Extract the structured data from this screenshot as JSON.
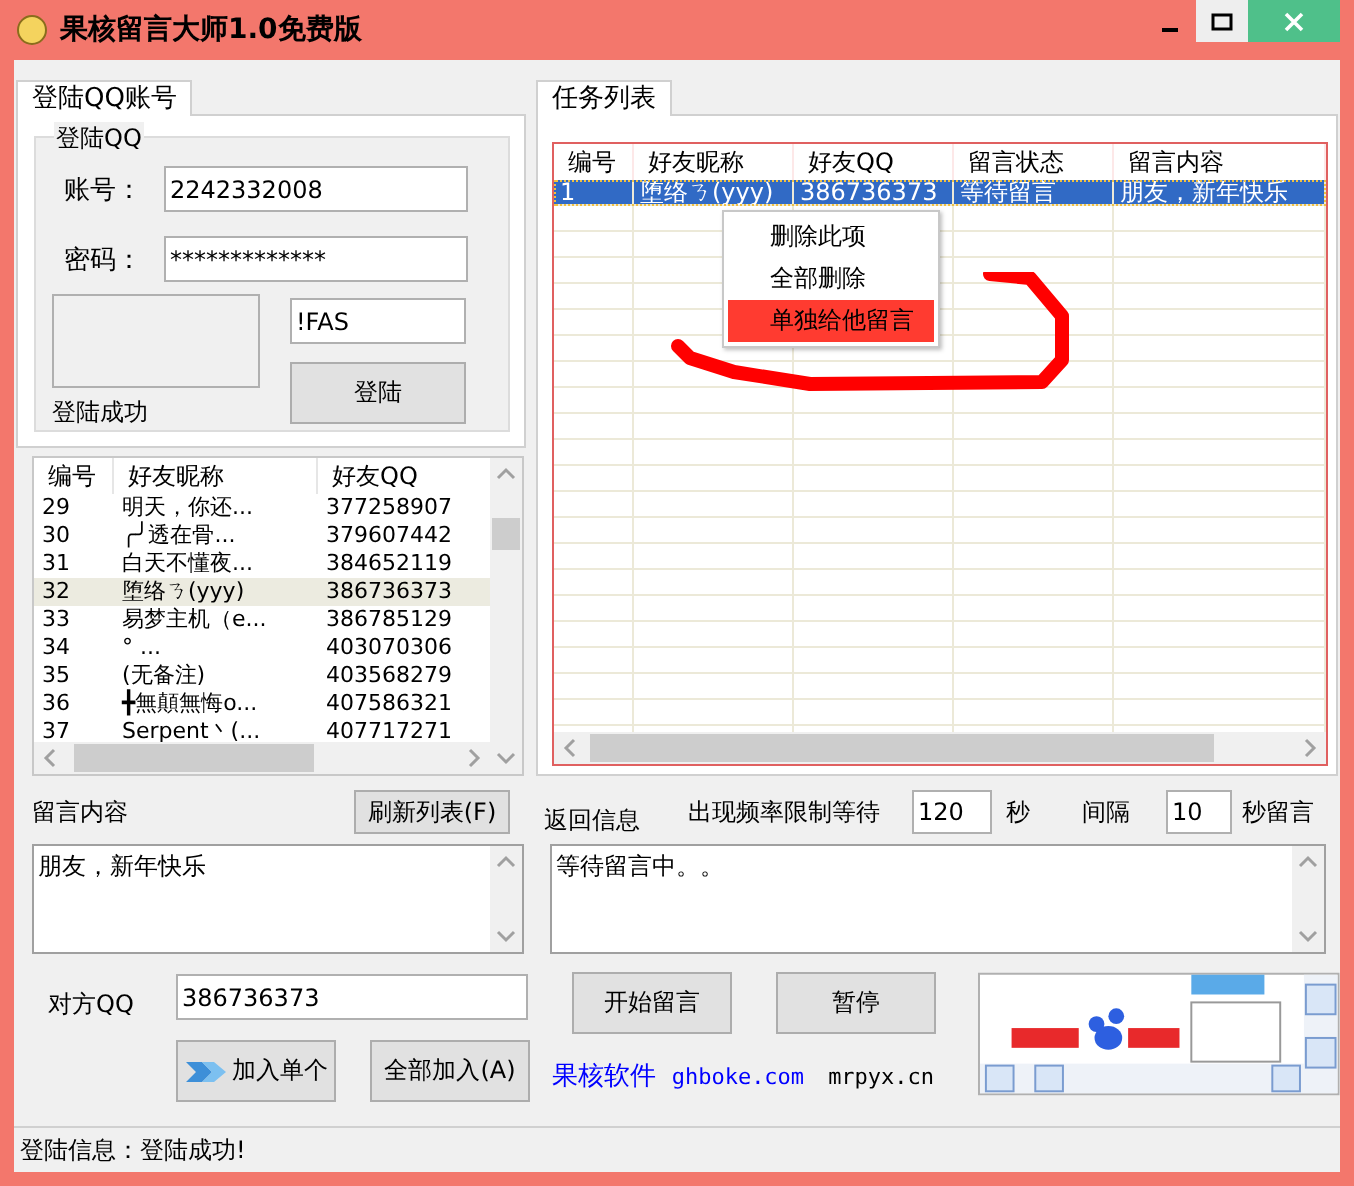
{
  "window": {
    "title": "果核留言大师1.0免费版"
  },
  "login_tab": {
    "label": "登陆QQ账号",
    "selected": true
  },
  "login_group": {
    "title": "登陆QQ",
    "account_label": "账号：",
    "account": "2242332008",
    "password_label": "密码：",
    "password": "*************",
    "captcha": "!FAS",
    "login_button": "登陆",
    "status": "登陆成功"
  },
  "friends": {
    "columns": [
      "编号",
      "好友昵称",
      "好友QQ"
    ],
    "rows": [
      {
        "cells": [
          "29",
          "明天，你还...",
          "377258907"
        ],
        "selected": false
      },
      {
        "cells": [
          "30",
          "╭╯透在骨...",
          "379607442"
        ],
        "selected": false
      },
      {
        "cells": [
          "31",
          "白天不懂夜...",
          "384652119"
        ],
        "selected": false
      },
      {
        "cells": [
          "32",
          "堕络ㄋ(yyy)",
          "386736373"
        ],
        "selected": true
      },
      {
        "cells": [
          "33",
          "易梦主机（e...",
          "386785129"
        ],
        "selected": false
      },
      {
        "cells": [
          "34",
          "° ...",
          "403070306"
        ],
        "selected": false
      },
      {
        "cells": [
          "35",
          "(无备注)",
          "403568279"
        ],
        "selected": false
      },
      {
        "cells": [
          "36",
          "╋無顛無悔o...",
          "407586321"
        ],
        "selected": false
      },
      {
        "cells": [
          "37",
          "Serpent丶(...",
          "407717271"
        ],
        "selected": false
      }
    ]
  },
  "task_tab": {
    "label": "任务列表",
    "selected": true
  },
  "tasks": {
    "columns": [
      "编号",
      "好友昵称",
      "好友QQ",
      "留言状态",
      "留言内容"
    ],
    "rows": [
      {
        "cells": [
          "1",
          "堕络ㄋ(yyy)",
          "386736373",
          "等待留言",
          "朋友，新年快乐"
        ],
        "selected": true
      }
    ]
  },
  "context_menu": {
    "items": [
      {
        "label": "删除此项",
        "selected": false
      },
      {
        "label": "全部删除",
        "selected": false
      },
      {
        "label": "单独给他留言",
        "selected": true
      }
    ]
  },
  "message": {
    "label": "留言内容",
    "refresh_button": "刷新列表(F)",
    "text": "朋友，新年快乐"
  },
  "return_info": {
    "label": "返回信息",
    "rate_label": "出现频率限制等待",
    "wait": "120",
    "seconds_label": "秒",
    "interval_label": "间隔",
    "interval": "10",
    "interval_unit": "秒留言",
    "text": "等待留言中。。"
  },
  "target": {
    "label": "对方QQ",
    "value": "386736373"
  },
  "buttons": {
    "start": "开始留言",
    "pause": "暂停",
    "add_one": "加入单个",
    "add_all": "全部加入(A)"
  },
  "links": [
    {
      "text": "果核软件",
      "kind": "brand"
    },
    {
      "text": "ghboke.com",
      "kind": "link"
    },
    {
      "text": "mrpyx.cn",
      "kind": "plain"
    }
  ],
  "status_bar": {
    "text": "登陆信息：登陆成功!"
  }
}
